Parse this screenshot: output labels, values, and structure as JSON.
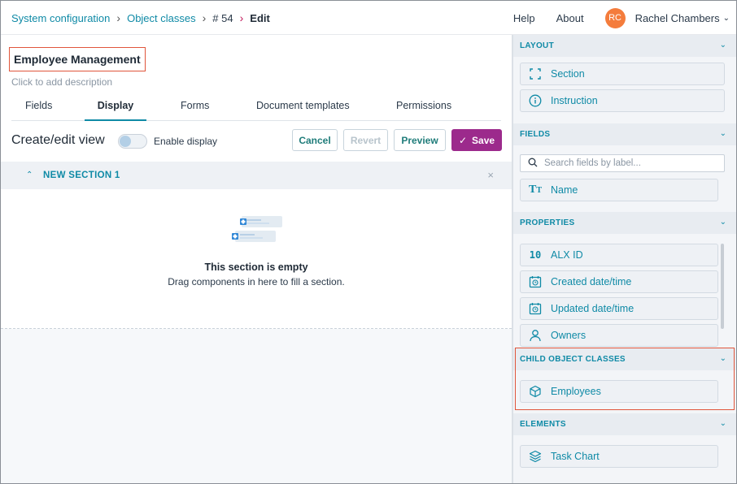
{
  "breadcrumb": {
    "items": [
      "System configuration",
      "Object classes",
      "# 54",
      "Edit"
    ]
  },
  "header": {
    "help": "Help",
    "about": "About",
    "avatar_initials": "RC",
    "user_name": "Rachel Chambers"
  },
  "page": {
    "title": "Employee Management",
    "description_placeholder": "Click to add description"
  },
  "tabs": [
    "Fields",
    "Display",
    "Forms",
    "Document templates",
    "Permissions"
  ],
  "active_tab": "Display",
  "toolbar": {
    "title": "Create/edit view",
    "toggle_label": "Enable display",
    "toggle_on": false,
    "cancel": "Cancel",
    "revert": "Revert",
    "preview": "Preview",
    "save": "Save"
  },
  "section": {
    "label": "NEW SECTION 1",
    "empty_title": "This section is empty",
    "empty_sub": "Drag components in here to fill a section."
  },
  "panel": {
    "layout": {
      "title": "LAYOUT",
      "items": [
        {
          "label": "Section",
          "icon": "section-icon"
        },
        {
          "label": "Instruction",
          "icon": "info-icon"
        }
      ]
    },
    "fields": {
      "title": "FIELDS",
      "search_placeholder": "Search fields by label...",
      "items": [
        {
          "label": "Name",
          "icon": "text-field-icon"
        }
      ]
    },
    "properties": {
      "title": "PROPERTIES",
      "items": [
        {
          "label": "ALX ID",
          "icon": "id-number-icon",
          "glyph": "10"
        },
        {
          "label": "Created date/time",
          "icon": "calendar-clock-icon"
        },
        {
          "label": "Updated date/time",
          "icon": "calendar-clock-icon"
        },
        {
          "label": "Owners",
          "icon": "user-icon"
        }
      ]
    },
    "child_object_classes": {
      "title": "CHILD OBJECT CLASSES",
      "items": [
        {
          "label": "Employees",
          "icon": "cube-icon"
        }
      ]
    },
    "elements": {
      "title": "ELEMENTS",
      "items": [
        {
          "label": "Task Chart",
          "icon": "stack-icon"
        }
      ]
    }
  },
  "colors": {
    "accent": "#0f8aa6",
    "save": "#9c2a8c",
    "avatar": "#f47c3c",
    "highlight": "#e0553b"
  }
}
